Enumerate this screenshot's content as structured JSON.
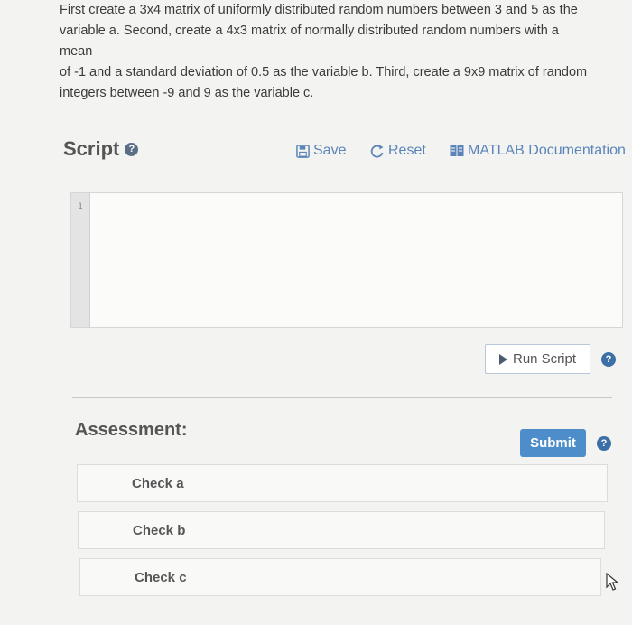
{
  "instructions": {
    "line1": "First create a 3x4 matrix of uniformly distributed random numbers between 3 and 5 as the",
    "line2": "variable a. Second, create a 4x3 matrix of normally distributed random numbers with a mean",
    "line3": "of -1 and a standard deviation of 0.5 as the variable b. Third, create a 9x9 matrix of random",
    "line4": "integers between -9 and 9 as the variable c."
  },
  "script": {
    "title": "Script",
    "help_glyph": "?",
    "save_label": "Save",
    "reset_label": "Reset",
    "docs_label": "MATLAB Documentation",
    "line_number": "1",
    "code": ""
  },
  "run": {
    "label": "Run Script",
    "help_glyph": "?"
  },
  "assessment": {
    "title": "Assessment:",
    "submit_label": "Submit",
    "help_glyph": "?",
    "checks": [
      "Check a",
      "Check b",
      "Check c"
    ]
  },
  "colors": {
    "accent": "#4d8dc9",
    "link": "#5b85b8",
    "help": "#3c6fa6"
  },
  "icons": {
    "save": "floppy-disk-icon",
    "reset": "refresh-icon",
    "docs": "book-icon",
    "run": "play-triangle-icon",
    "help": "question-circle-icon",
    "cursor": "mouse-pointer-icon"
  }
}
